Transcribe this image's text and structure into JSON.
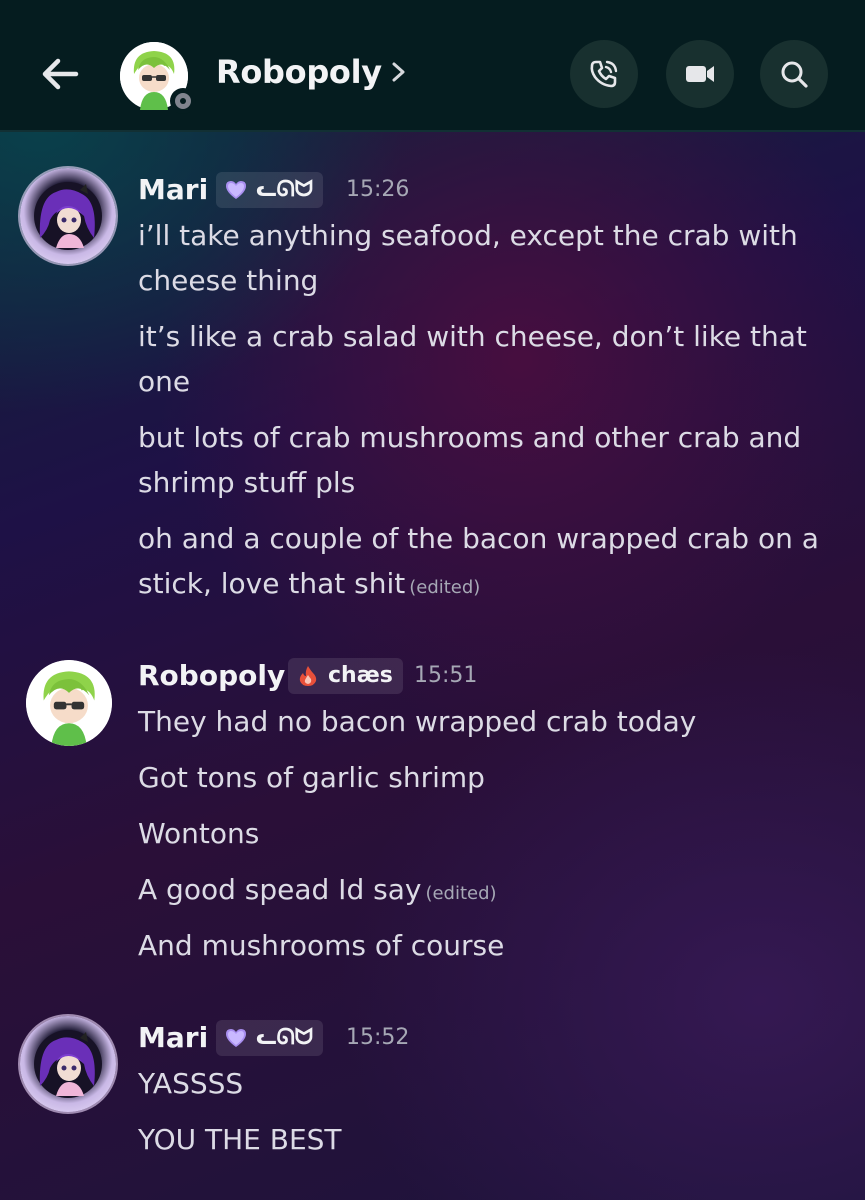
{
  "header": {
    "title": "Robopoly",
    "back_icon": "arrow-left-icon",
    "chevron_icon": "chevron-right-icon",
    "buttons": [
      "phone-call-icon",
      "video-camera-icon",
      "search-icon"
    ]
  },
  "colors": {
    "header_bg": "#051c1f",
    "button_bg": "#18302f",
    "text": "#dcdbe5",
    "timestamp": "#a6a8b5"
  },
  "messages": [
    {
      "author": "Mari",
      "tag_icon": "purple-heart-icon",
      "tag": "ᓚᘏᗢ",
      "time": "15:26",
      "lines": [
        "i’ll take anything seafood, except the crab with",
        "cheese thing",
        "it’s like a crab salad with cheese, don’t like that",
        "one",
        "but lots of crab mushrooms and other crab and",
        "shrimp stuff pls",
        "oh and a couple of the bacon wrapped crab on a",
        "stick, love that shit"
      ],
      "edited": "(edited)"
    },
    {
      "author": "Robopoly",
      "tag_icon": "flame-icon",
      "tag": "chæs",
      "time": "15:51",
      "lines": [
        "They had no bacon wrapped crab today",
        "Got tons of garlic shrimp",
        "Wontons",
        "A good spead Id say",
        "And mushrooms of course"
      ],
      "edited": "(edited)"
    },
    {
      "author": "Mari",
      "tag_icon": "purple-heart-icon",
      "tag": "ᓚᘏᗢ",
      "time": "15:52",
      "lines": [
        "YASSSS",
        "YOU THE BEST"
      ]
    }
  ]
}
